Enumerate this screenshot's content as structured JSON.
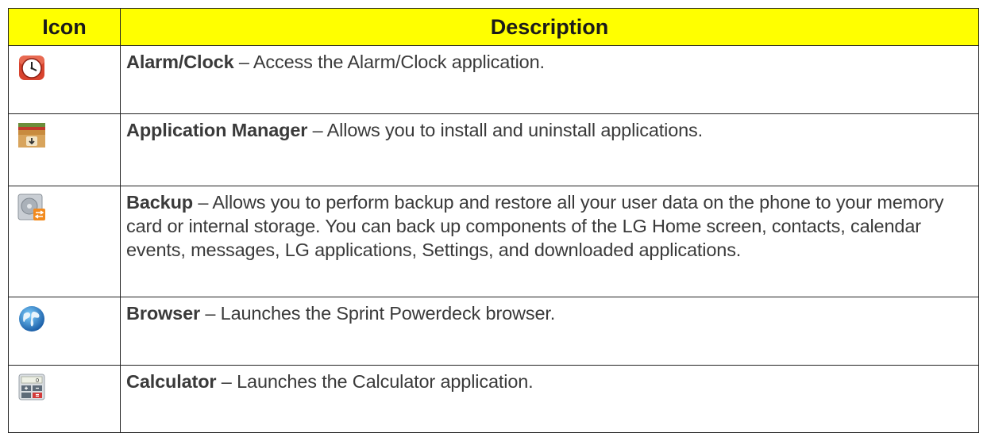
{
  "table": {
    "headers": {
      "icon": "Icon",
      "description": "Description"
    },
    "rows": [
      {
        "icon": "alarm-clock-icon",
        "title": "Alarm/Clock",
        "text": " – Access the Alarm/Clock application."
      },
      {
        "icon": "application-manager-icon",
        "title": "Application Manager",
        "text": " – Allows you to install and uninstall applications."
      },
      {
        "icon": "backup-icon",
        "title": "Backup",
        "text": " – Allows you to perform backup and restore all your user data on the phone to your memory card or internal storage. You can back up components of the LG Home screen, contacts, calendar events, messages, LG applications, Settings, and downloaded applications."
      },
      {
        "icon": "browser-globe-icon",
        "title": "Browser",
        "text": " – Launches the Sprint Powerdeck browser."
      },
      {
        "icon": "calculator-icon",
        "title": "Calculator",
        "text": " – Launches the Calculator application."
      }
    ]
  },
  "colors": {
    "header_bg": "#ffff00",
    "text": "#3a3a3a",
    "border": "#222222"
  }
}
